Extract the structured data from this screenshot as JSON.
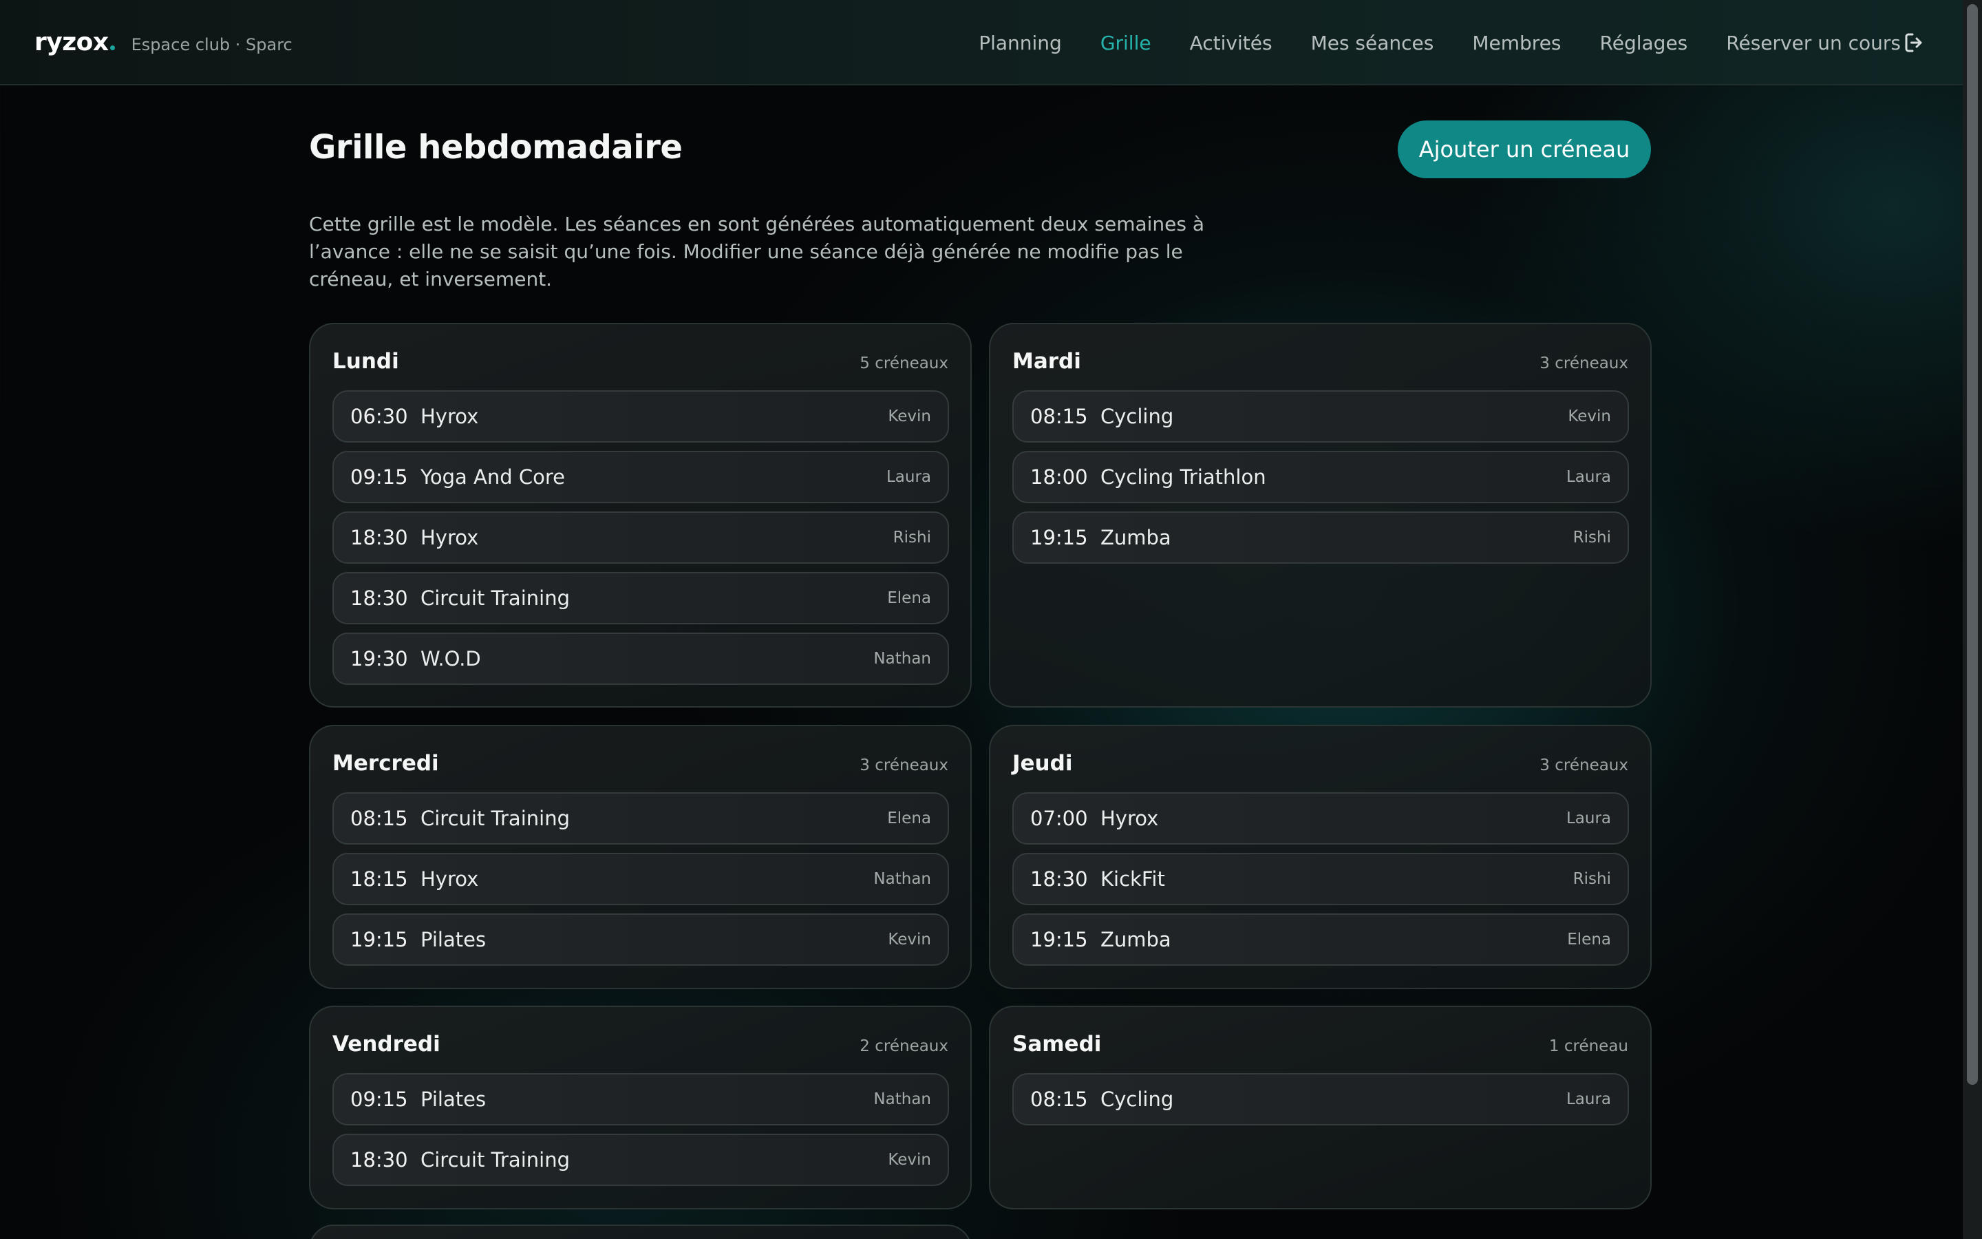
{
  "header": {
    "logo": "ryzox",
    "club": "Espace club · Sparc",
    "nav": [
      {
        "label": "Planning",
        "active": false
      },
      {
        "label": "Grille",
        "active": true
      },
      {
        "label": "Activités",
        "active": false
      },
      {
        "label": "Mes séances",
        "active": false
      },
      {
        "label": "Membres",
        "active": false
      },
      {
        "label": "Réglages",
        "active": false
      },
      {
        "label": "Réserver un cours",
        "active": false
      }
    ],
    "logout_icon": "logout-icon"
  },
  "main": {
    "title": "Grille hebdomadaire",
    "add_button": "Ajouter un créneau",
    "intro": "Cette grille est le modèle. Les séances en sont générées automatiquement deux semaines à l’avance : elle ne se saisit qu’une fois. Modifier une séance déjà générée ne modifie pas le créneau, et inversement."
  },
  "days": [
    {
      "name": "Lundi",
      "count": "5 créneaux",
      "slots": [
        {
          "time": "06:30",
          "activity": "Hyrox",
          "coach": "Kevin"
        },
        {
          "time": "09:15",
          "activity": "Yoga And Core",
          "coach": "Laura"
        },
        {
          "time": "18:30",
          "activity": "Hyrox",
          "coach": "Rishi"
        },
        {
          "time": "18:30",
          "activity": "Circuit Training",
          "coach": "Elena"
        },
        {
          "time": "19:30",
          "activity": "W.O.D",
          "coach": "Nathan"
        }
      ]
    },
    {
      "name": "Mardi",
      "count": "3 créneaux",
      "slots": [
        {
          "time": "08:15",
          "activity": "Cycling",
          "coach": "Kevin"
        },
        {
          "time": "18:00",
          "activity": "Cycling Triathlon",
          "coach": "Laura"
        },
        {
          "time": "19:15",
          "activity": "Zumba",
          "coach": "Rishi"
        }
      ]
    },
    {
      "name": "Mercredi",
      "count": "3 créneaux",
      "slots": [
        {
          "time": "08:15",
          "activity": "Circuit Training",
          "coach": "Elena"
        },
        {
          "time": "18:15",
          "activity": "Hyrox",
          "coach": "Nathan"
        },
        {
          "time": "19:15",
          "activity": "Pilates",
          "coach": "Kevin"
        }
      ]
    },
    {
      "name": "Jeudi",
      "count": "3 créneaux",
      "slots": [
        {
          "time": "07:00",
          "activity": "Hyrox",
          "coach": "Laura"
        },
        {
          "time": "18:30",
          "activity": "KickFit",
          "coach": "Rishi"
        },
        {
          "time": "19:15",
          "activity": "Zumba",
          "coach": "Elena"
        }
      ]
    },
    {
      "name": "Vendredi",
      "count": "2 créneaux",
      "slots": [
        {
          "time": "09:15",
          "activity": "Pilates",
          "coach": "Nathan"
        },
        {
          "time": "18:30",
          "activity": "Circuit Training",
          "coach": "Kevin"
        }
      ]
    },
    {
      "name": "Samedi",
      "count": "1 créneau",
      "slots": [
        {
          "time": "08:15",
          "activity": "Cycling",
          "coach": "Laura"
        }
      ]
    }
  ],
  "colors": {
    "accent": "#25b3ac",
    "button": "#0f8886",
    "background": "#050607"
  }
}
